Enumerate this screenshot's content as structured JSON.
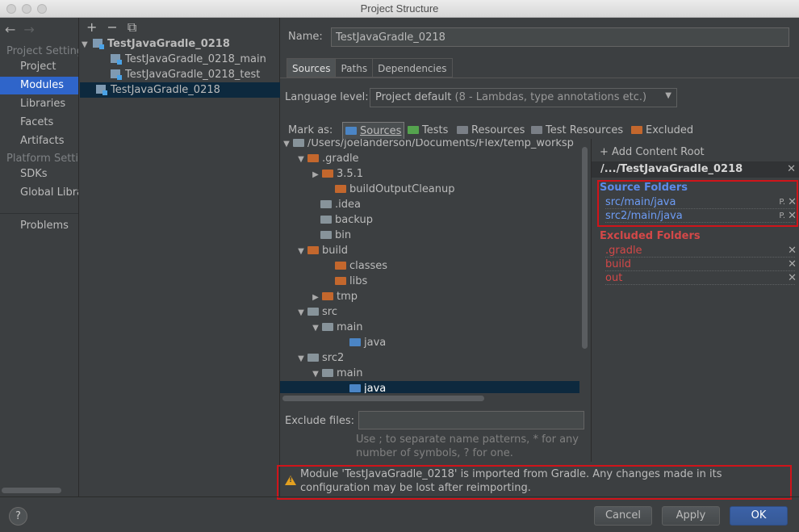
{
  "window": {
    "title": "Project Structure"
  },
  "nav": {
    "back_icon": "arrow-left-icon",
    "forward_icon": "arrow-right-icon",
    "project_settings_header": "Project Settings",
    "platform_settings_header": "Platform Settings",
    "items": [
      {
        "label": "Project"
      },
      {
        "label": "Modules"
      },
      {
        "label": "Libraries"
      },
      {
        "label": "Facets"
      },
      {
        "label": "Artifacts"
      },
      {
        "label": "SDKs"
      },
      {
        "label": "Global Libraries"
      },
      {
        "label": "Problems"
      }
    ]
  },
  "modules": {
    "toolbar": {
      "add": "+",
      "remove": "−",
      "copy_icon": "copy-icon"
    },
    "items": [
      {
        "label": "TestJavaGradle_0218"
      },
      {
        "label": "TestJavaGradle_0218_main"
      },
      {
        "label": "TestJavaGradle_0218_test"
      },
      {
        "label": "TestJavaGradle_0218"
      }
    ]
  },
  "editor": {
    "name_label": "Name:",
    "name_value": "TestJavaGradle_0218",
    "tabs": [
      "Sources",
      "Paths",
      "Dependencies"
    ],
    "selected_tab": "Sources",
    "language_label": "Language level:",
    "language_value": "Project default",
    "language_detail": "(8 - Lambdas, type annotations etc.)",
    "mark_as_label": "Mark as:",
    "mark_options": [
      {
        "label": "Sources",
        "color": "#4b85c5"
      },
      {
        "label": "Tests",
        "color": "#55a34e"
      },
      {
        "label": "Resources",
        "color": "#7a7f86"
      },
      {
        "label": "Test Resources",
        "color": "#7a7f86"
      },
      {
        "label": "Excluded",
        "color": "#c3672d"
      }
    ],
    "tree": [
      {
        "label": "/Users/joelanderson/Documents/Flex/temp_worksp"
      },
      {
        "label": ".gradle"
      },
      {
        "label": "3.5.1"
      },
      {
        "label": "buildOutputCleanup"
      },
      {
        "label": ".idea"
      },
      {
        "label": "backup"
      },
      {
        "label": "bin"
      },
      {
        "label": "build"
      },
      {
        "label": "classes"
      },
      {
        "label": "libs"
      },
      {
        "label": "tmp"
      },
      {
        "label": "src"
      },
      {
        "label": "main"
      },
      {
        "label": "java"
      },
      {
        "label": "src2"
      },
      {
        "label": "main"
      },
      {
        "label": "java"
      }
    ],
    "exclude_label": "Exclude files:",
    "exclude_value": "",
    "exclude_hint": "Use ; to separate name patterns, * for any number of symbols, ? for one."
  },
  "content_root": {
    "add_label": "Add Content Root",
    "path": "/.../TestJavaGradle_0218",
    "source_title": "Source Folders",
    "source_folders": [
      "src/main/java",
      "src2/main/java"
    ],
    "excluded_title": "Excluded Folders",
    "excluded_folders": [
      ".gradle",
      "build",
      "out"
    ]
  },
  "warning": {
    "icon": "warning-icon",
    "text": "Module 'TestJavaGradle_0218' is imported from Gradle. Any changes made in its configuration may be lost after reimporting."
  },
  "buttons": {
    "help": "?",
    "cancel": "Cancel",
    "apply": "Apply",
    "ok": "OK"
  }
}
